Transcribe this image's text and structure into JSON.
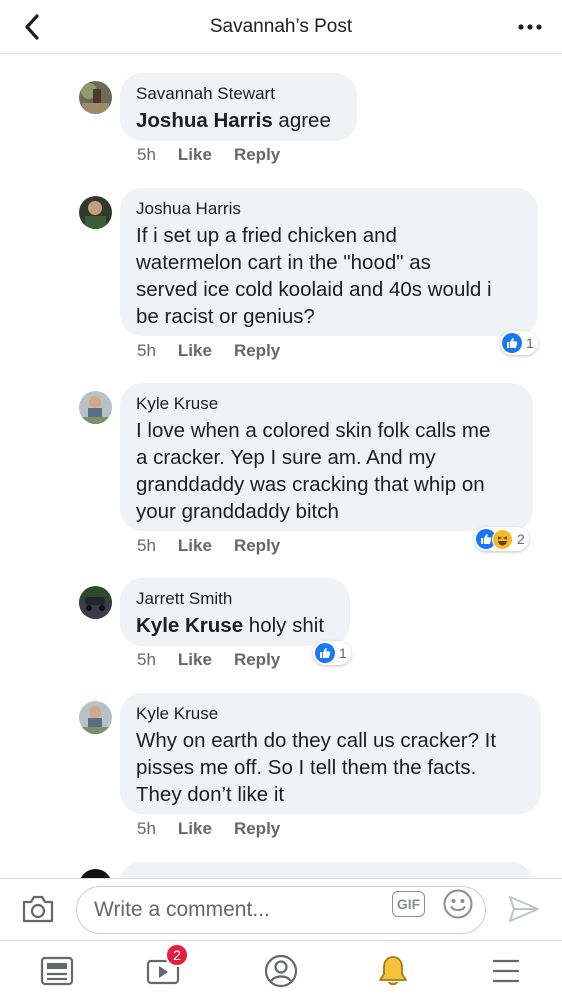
{
  "header": {
    "title": "Savannah’s Post",
    "back_icon": "chevron-left-icon",
    "more_icon": "more-horizontal-icon"
  },
  "actions": {
    "like": "Like",
    "reply": "Reply"
  },
  "comments": [
    {
      "author": "Savannah Stewart",
      "mention": "Joshua Harris",
      "text": " agree",
      "time": "5h",
      "reactions": null
    },
    {
      "author": "Joshua Harris",
      "lines": [
        "If i set up a fried chicken and",
        "watermelon cart in the \"hood\" as",
        "served ice cold koolaid and 40s would i",
        "be racist or genius?"
      ],
      "time": "5h",
      "reactions": {
        "types": [
          "like"
        ],
        "count": "1"
      }
    },
    {
      "author": "Kyle Kruse",
      "lines": [
        "I love when a colored skin folk calls me",
        "a cracker. Yep I sure am. And my",
        "granddaddy was cracking that whip on",
        "your granddaddy bitch"
      ],
      "time": "5h",
      "reactions": {
        "types": [
          "like",
          "haha"
        ],
        "count": "2"
      }
    },
    {
      "author": "Jarrett Smith",
      "mention": "Kyle Kruse",
      "text": " holy shit",
      "time": "5h",
      "reactions": {
        "types": [
          "like"
        ],
        "count": "1"
      }
    },
    {
      "author": "Kyle Kruse",
      "lines": [
        "Why on earth do they call us cracker? It",
        "pisses me off. So I tell them the facts.",
        "They don’t like it"
      ],
      "time": "5h",
      "reactions": null
    }
  ],
  "compose": {
    "placeholder": "Write a comment...",
    "gif_label": "GIF",
    "camera_icon": "camera-icon",
    "emoji_icon": "emoji-icon",
    "send_icon": "send-icon"
  },
  "nav": {
    "items": [
      {
        "icon": "news-feed-icon"
      },
      {
        "icon": "watch-icon",
        "badge": "2"
      },
      {
        "icon": "profile-icon"
      },
      {
        "icon": "notifications-bell-icon"
      },
      {
        "icon": "menu-icon"
      }
    ]
  },
  "colors": {
    "accent": "#1877f2",
    "bubble": "#f0f2f5",
    "meta_text": "#65676b",
    "badge": "#e41e3f",
    "bell_active": "#f5c33b"
  }
}
